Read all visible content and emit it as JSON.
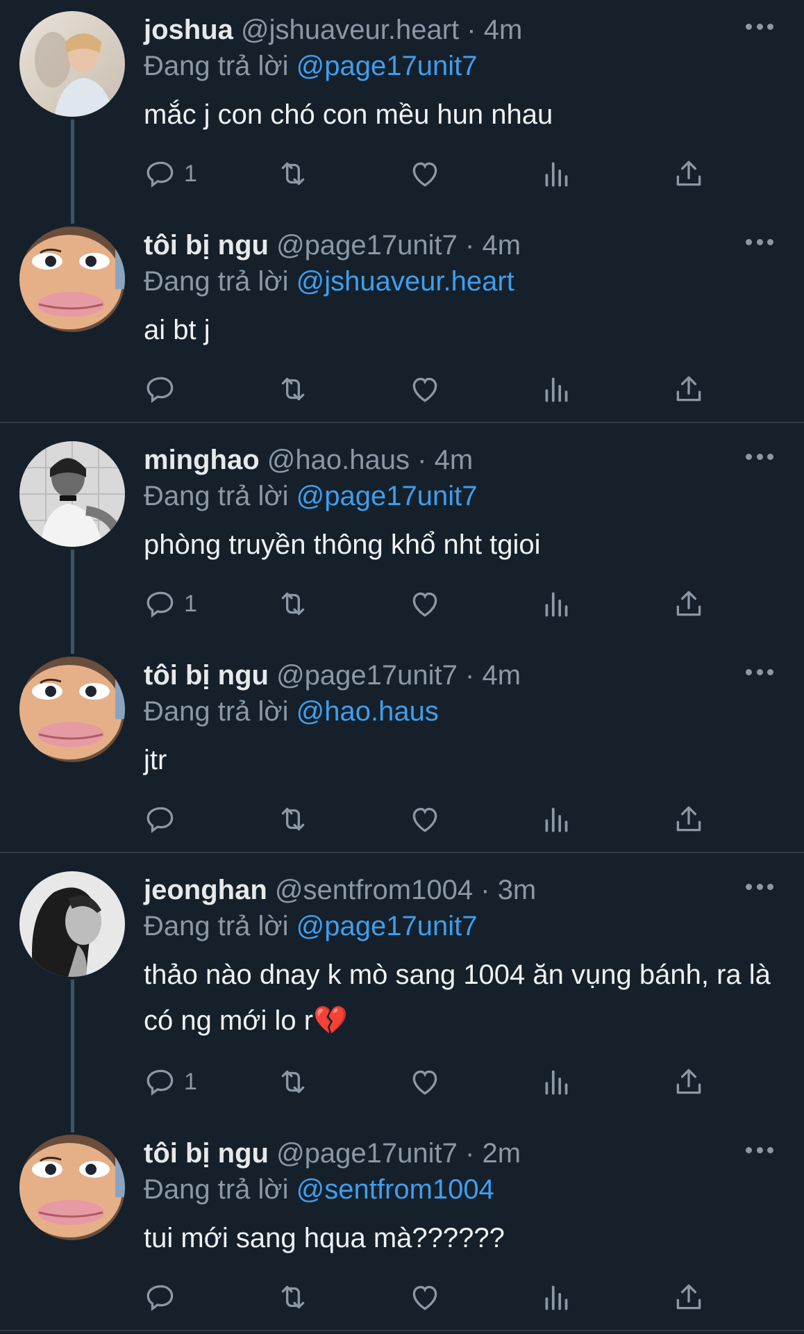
{
  "tweets": [
    {
      "name": "joshua",
      "handle": "@jshuaveur.heart",
      "dot": "·",
      "time": "4m",
      "replying_label": "Đang trả lời",
      "replying_to": "@page17unit7",
      "text": "mắc j con chó con mều hun nhau",
      "reply_count": "1"
    },
    {
      "name": "tôi bị ngu",
      "handle": "@page17unit7",
      "dot": "·",
      "time": "4m",
      "replying_label": "Đang trả lời",
      "replying_to": "@jshuaveur.heart",
      "text": "ai bt j",
      "reply_count": ""
    },
    {
      "name": "minghao",
      "handle": "@hao.haus",
      "dot": "·",
      "time": "4m",
      "replying_label": "Đang trả lời",
      "replying_to": "@page17unit7",
      "text": "phòng truyền thông khổ nht tgioi",
      "reply_count": "1"
    },
    {
      "name": "tôi bị ngu",
      "handle": "@page17unit7",
      "dot": "·",
      "time": "4m",
      "replying_label": "Đang trả lời",
      "replying_to": "@hao.haus",
      "text": "jtr",
      "reply_count": ""
    },
    {
      "name": "jeonghan",
      "handle": "@sentfrom1004",
      "dot": "·",
      "time": "3m",
      "replying_label": "Đang trả lời",
      "replying_to": "@page17unit7",
      "text": "thảo nào dnay k mò sang 1004 ăn vụng bánh, ra là có ng mới lo r💔",
      "reply_count": "1"
    },
    {
      "name": "tôi bị ngu",
      "handle": "@page17unit7",
      "dot": "·",
      "time": "2m",
      "replying_label": "Đang trả lời",
      "replying_to": "@sentfrom1004",
      "text": "tui mới sang hqua mà??????",
      "reply_count": ""
    }
  ],
  "icons": {
    "reply": "reply-icon",
    "retweet": "retweet-icon",
    "like": "heart-icon",
    "views": "views-icon",
    "share": "share-icon",
    "more": "more-icon"
  },
  "colors": {
    "background": "#15202b",
    "mention": "#3f9eed",
    "muted": "#8b98a5",
    "separator": "#2f3d4a",
    "thread_line": "#3d5466"
  }
}
